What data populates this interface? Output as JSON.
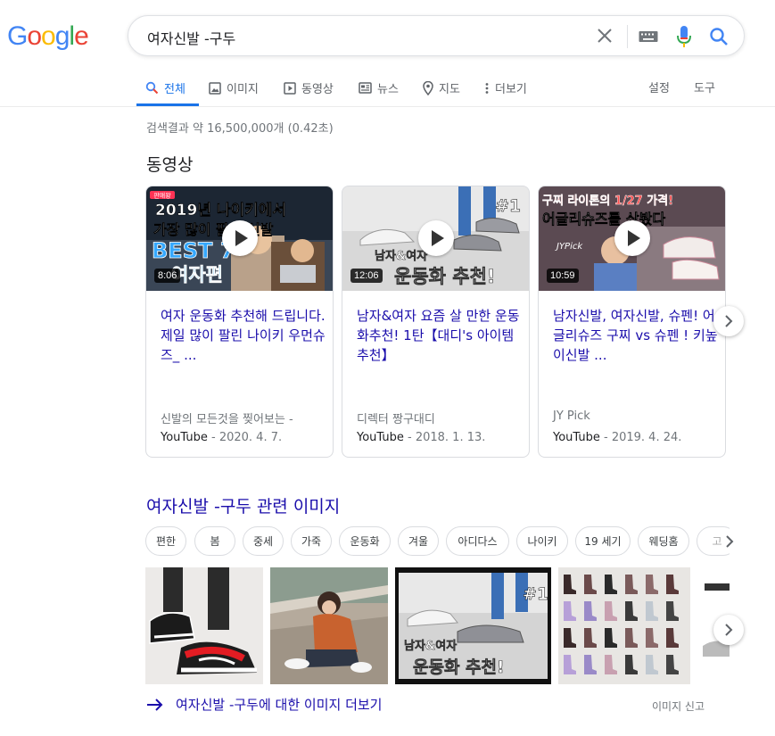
{
  "logo": {
    "letters": [
      "G",
      "o",
      "o",
      "g",
      "l",
      "e"
    ],
    "colors": [
      "#4285f4",
      "#ea4335",
      "#fbbc05",
      "#4285f4",
      "#34a853",
      "#ea4335"
    ]
  },
  "search": {
    "query": "여자신발 -구두",
    "icons": [
      "close-icon",
      "keyboard-icon",
      "mic-icon",
      "search-icon"
    ]
  },
  "tabs": [
    {
      "label": "전체",
      "icon": "search-icon",
      "active": true
    },
    {
      "label": "이미지",
      "icon": "image-icon"
    },
    {
      "label": "동영상",
      "icon": "video-icon"
    },
    {
      "label": "뉴스",
      "icon": "news-icon"
    },
    {
      "label": "지도",
      "icon": "pin-icon"
    },
    {
      "label": "더보기",
      "icon": "more-vert-icon"
    }
  ],
  "tools": {
    "settings": "설정",
    "tools": "도구"
  },
  "result_stats": "검색결과 약 16,500,000개 (0.42초)",
  "videos": {
    "section_title": "동영상",
    "items": [
      {
        "overlay_lines": [
          "2019년 나이키에서",
          "가장 많이 팔린 신발",
          "BEST 7",
          "여자편"
        ],
        "tag": "판매왕",
        "duration": "8:06",
        "title": "여자 운동화 추천해 드립니다. 제일 많이 팔린 나이키 우먼슈즈_ ...",
        "channel": "신발의 모든것을 찢어보는 -",
        "source": "YouTube",
        "date": " - 2020. 4. 7."
      },
      {
        "overlay_lines": [
          "#1",
          "남자&여자",
          "운동화 추천!"
        ],
        "duration": "12:06",
        "title": "남자&여자 요즘 살 만한 운동화추천! 1탄【대디's 아이템추천】",
        "channel": "디렉터 짱구대디",
        "source": "YouTube",
        "date": " - 2018. 1. 13."
      },
      {
        "overlay_lines": [
          "구찌 라이톤의 1/27 가격!",
          "어글리슈즈를 샀봤다",
          "JYPick"
        ],
        "duration": "10:59",
        "title": "남자신발, 여자신발, 슈펜! 어글리슈즈 구찌 vs 슈펜 ! 키높이신발 ...",
        "channel": "JY Pick",
        "source": "YouTube",
        "date": " - 2019. 4. 24."
      }
    ]
  },
  "images": {
    "title": "여자신발 -구두 관련 이미지",
    "chips": [
      "편한",
      "봄",
      "중세",
      "가죽",
      "운동화",
      "겨울",
      "아디다스",
      "나이키",
      "19 세기",
      "웨딩홈",
      "고"
    ],
    "tile_overlays": {
      "tile3": [
        "#1",
        "남자&여자",
        "운동화 추천!"
      ]
    },
    "more": "여자신발 -구두에 대한 이미지 더보기",
    "report": "이미지 신고"
  }
}
